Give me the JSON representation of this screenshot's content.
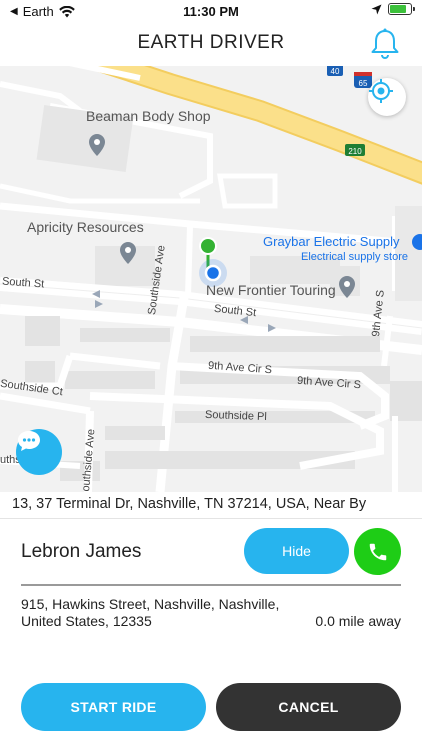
{
  "status_bar": {
    "carrier": "Earth",
    "time": "11:30 PM",
    "battery_level": 0.85
  },
  "header": {
    "title": "EARTH DRIVER",
    "notification_icon": "bell-icon"
  },
  "map": {
    "places": {
      "beaman": "Beaman Body Shop",
      "apricity": "Apricity Resources",
      "graybar": "Graybar Electric Supply",
      "graybar_category": "Electrical supply store",
      "new_frontier": "New Frontier Touring"
    },
    "streets": {
      "south_st_left": "South St",
      "south_st_right": "South St",
      "southside_ave": "Southside Ave",
      "ninth_ave_s": "9th Ave S",
      "ninth_ave_cir_s": "9th Ave Cir S",
      "ninth_ave_cir_s_2": "9th Ave Cir S",
      "southside_ct": "Southside Ct",
      "southside_pl": "Southside Pl",
      "southside_ave_lower": "outhside Ave",
      "southside_edge": "uthsi"
    },
    "shields": {
      "i40": "40",
      "i65": "65",
      "us210": "210"
    },
    "colors": {
      "highway": "#fbe08a",
      "highway_edge": "#f3cd5f",
      "road": "#ffffff",
      "land": "#f2f2f2",
      "building": "#e8e8e8",
      "pin": "#7b8794",
      "pickup_pin": "#34b233",
      "current_location": "#1a73e8"
    }
  },
  "trip": {
    "address_line": "13, 37 Terminal Dr, Nashville, TN 37214, USA,  Near By",
    "rider_name": "Lebron James",
    "hide_label": "Hide",
    "pickup_address": "915, Hawkins Street, Nashville, Nashville, United States, 12335",
    "distance": "0.0 mile away"
  },
  "actions": {
    "start_label": "START RIDE",
    "cancel_label": "CANCEL"
  },
  "theme": {
    "accent": "#27b4ee",
    "call_green": "#1ecd16",
    "dark_button": "#333333"
  }
}
